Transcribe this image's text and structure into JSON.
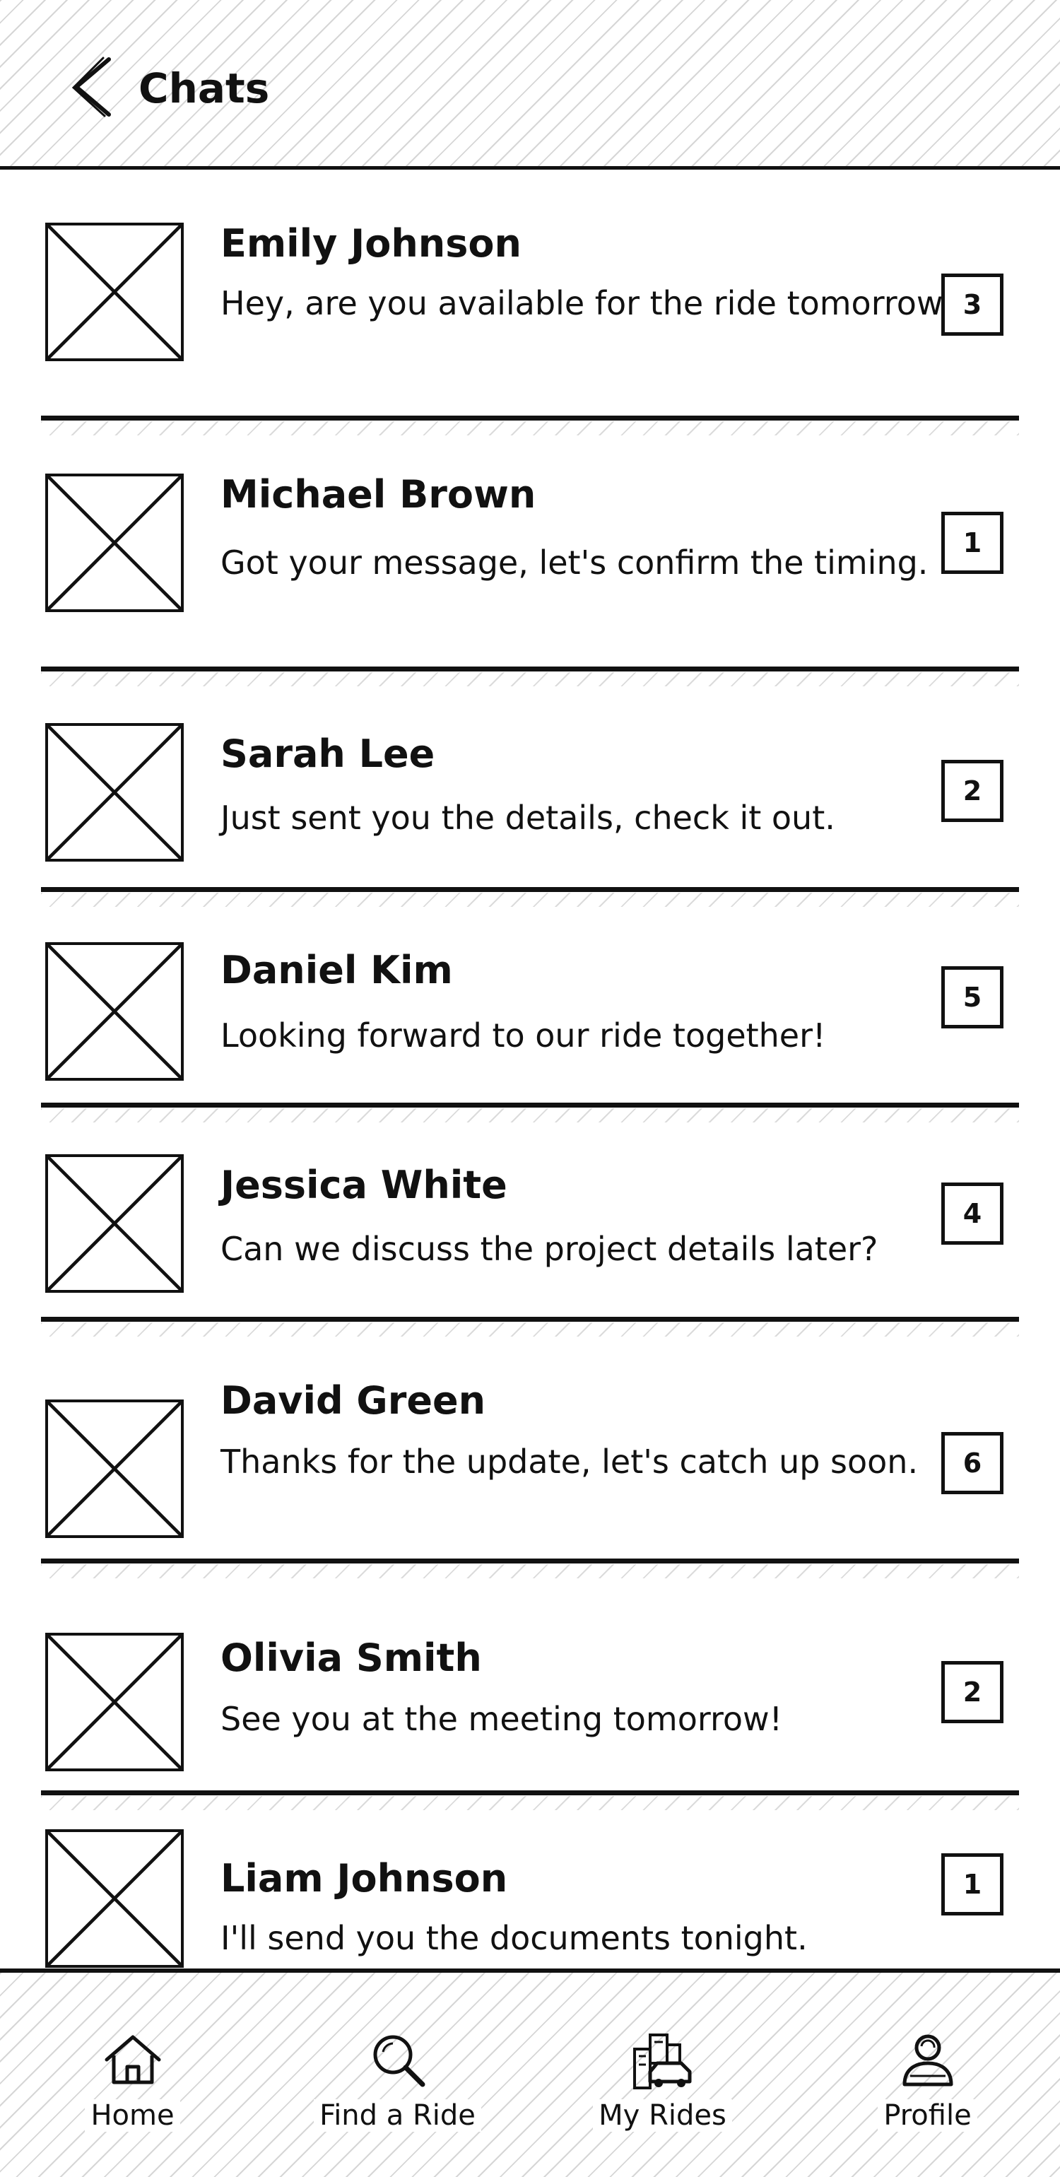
{
  "header": {
    "title": "Chats",
    "back_icon": "chevron-left-icon"
  },
  "chats": [
    {
      "name": "Emily Johnson",
      "message": "Hey, are you available for the ride tomorrow?",
      "unread": "3"
    },
    {
      "name": "Michael Brown",
      "message": "Got your message, let's confirm the timing.",
      "unread": "1"
    },
    {
      "name": "Sarah Lee",
      "message": "Just sent you the details, check it out.",
      "unread": "2"
    },
    {
      "name": "Daniel Kim",
      "message": "Looking forward to our ride together!",
      "unread": "5"
    },
    {
      "name": "Jessica White",
      "message": "Can we discuss the project details later?",
      "unread": "4"
    },
    {
      "name": "David Green",
      "message": "Thanks for the update, let's catch up soon.",
      "unread": "6"
    },
    {
      "name": "Olivia Smith",
      "message": "See you at the meeting tomorrow!",
      "unread": "2"
    },
    {
      "name": "Liam Johnson",
      "message": "I'll send you the documents tonight.",
      "unread": "1"
    }
  ],
  "nav": {
    "items": [
      {
        "label": "Home",
        "icon": "home-icon"
      },
      {
        "label": "Find a Ride",
        "icon": "search-icon"
      },
      {
        "label": "My Rides",
        "icon": "car-city-icon"
      },
      {
        "label": "Profile",
        "icon": "profile-icon"
      }
    ]
  }
}
